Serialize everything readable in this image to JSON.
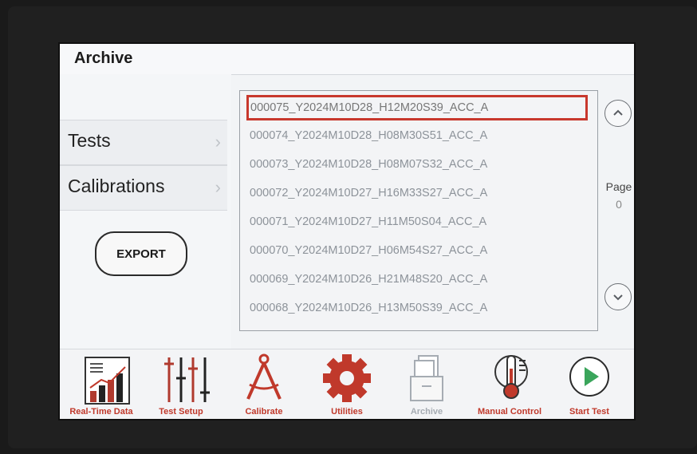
{
  "screen": {
    "title": "Archive"
  },
  "sidebar": {
    "items": [
      {
        "label": "Tests",
        "chevron": "›"
      },
      {
        "label": "Calibrations",
        "chevron": "›"
      }
    ],
    "export_label": "EXPORT"
  },
  "archive_list": {
    "rows": [
      "000075_Y2024M10D28_H12M20S39_ACC_A",
      "000074_Y2024M10D28_H08M30S51_ACC_A",
      "000073_Y2024M10D28_H08M07S32_ACC_A",
      "000072_Y2024M10D27_H16M33S27_ACC_A",
      "000071_Y2024M10D27_H11M50S04_ACC_A",
      "000070_Y2024M10D27_H06M54S27_ACC_A",
      "000069_Y2024M10D26_H21M48S20_ACC_A",
      "000068_Y2024M10D26_H13M50S39_ACC_A"
    ],
    "selected_index": 0
  },
  "pager": {
    "label": "Page",
    "value": "0",
    "up_icon": "chevron-up-icon",
    "down_icon": "chevron-down-icon"
  },
  "toolbar": {
    "items": [
      {
        "label": "Real-Time Data",
        "icon": "bar-chart-icon"
      },
      {
        "label": "Test Setup",
        "icon": "sliders-icon"
      },
      {
        "label": "Calibrate",
        "icon": "compass-icon"
      },
      {
        "label": "Utilities",
        "icon": "gear-icon"
      },
      {
        "label": "Archive",
        "icon": "file-cabinet-icon"
      },
      {
        "label": "Manual Control",
        "icon": "thermometer-icon"
      },
      {
        "label": "Start Test",
        "icon": "play-icon"
      }
    ]
  },
  "colors": {
    "accent_red": "#c0392b",
    "selection_border": "#c8382d",
    "play_green": "#3aa55b"
  }
}
